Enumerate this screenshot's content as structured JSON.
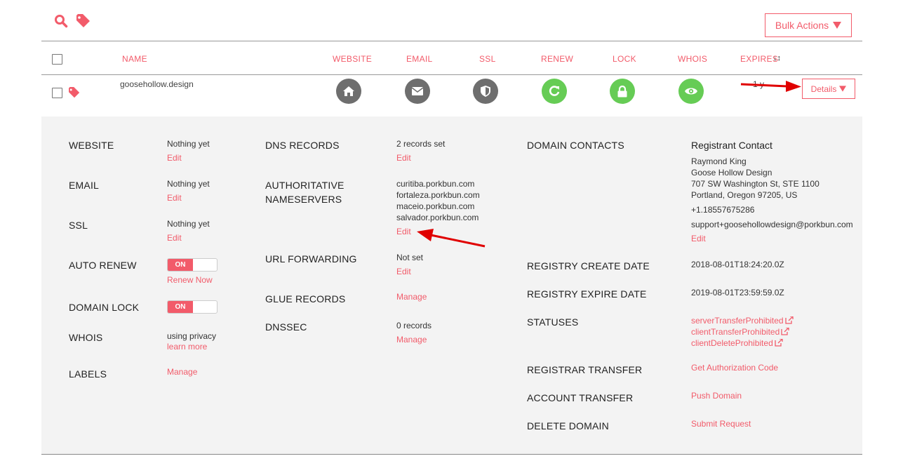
{
  "toolbar": {
    "bulk_actions_label": "Bulk Actions"
  },
  "table": {
    "headers": {
      "name": "NAME",
      "website": "WEBSITE",
      "email": "EMAIL",
      "ssl": "SSL",
      "renew": "RENEW",
      "lock": "LOCK",
      "whois": "WHOIS",
      "expires": "EXPIRES"
    },
    "row": {
      "domain": "goosehollow.design",
      "expires": "1 y",
      "details_label": "Details"
    }
  },
  "details": {
    "col1": {
      "website": {
        "label": "WEBSITE",
        "value": "Nothing yet",
        "action": "Edit"
      },
      "email": {
        "label": "EMAIL",
        "value": "Nothing yet",
        "action": "Edit"
      },
      "ssl": {
        "label": "SSL",
        "value": "Nothing yet",
        "action": "Edit"
      },
      "auto_renew": {
        "label": "AUTO RENEW",
        "toggle": "ON",
        "action": "Renew Now"
      },
      "domain_lock": {
        "label": "DOMAIN LOCK",
        "toggle": "ON"
      },
      "whois": {
        "label": "WHOIS",
        "value": "using privacy",
        "action": "learn more"
      },
      "labels": {
        "label": "LABELS",
        "action": "Manage"
      }
    },
    "col2": {
      "dns": {
        "label": "DNS RECORDS",
        "value": "2 records set",
        "action": "Edit"
      },
      "nameservers": {
        "label_line1": "AUTHORITATIVE",
        "label_line2": "NAMESERVERS",
        "values": [
          "curitiba.porkbun.com",
          "fortaleza.porkbun.com",
          "maceio.porkbun.com",
          "salvador.porkbun.com"
        ],
        "action": "Edit"
      },
      "url_forwarding": {
        "label": "URL FORWARDING",
        "value": "Not set",
        "action": "Edit"
      },
      "glue": {
        "label": "GLUE RECORDS",
        "action": "Manage"
      },
      "dnssec": {
        "label": "DNSSEC",
        "value": "0 records",
        "action": "Manage"
      }
    },
    "col3": {
      "contacts": {
        "label": "DOMAIN CONTACTS",
        "title": "Registrant Contact",
        "name": "Raymond King",
        "org": "Goose Hollow Design",
        "address1": "707 SW Washington St, STE 1100",
        "address2": "Portland, Oregon 97205, US",
        "phone": "+1.18557675286",
        "email": "support+goosehollowdesign@porkbun.com",
        "action": "Edit"
      },
      "create_date": {
        "label": "REGISTRY CREATE DATE",
        "value": "2018-08-01T18:24:20.0Z"
      },
      "expire_date": {
        "label": "REGISTRY EXPIRE DATE",
        "value": "2019-08-01T23:59:59.0Z"
      },
      "statuses": {
        "label": "STATUSES",
        "values": [
          "serverTransferProhibited",
          "clientTransferProhibited",
          "clientDeleteProhibited"
        ]
      },
      "registrar_transfer": {
        "label": "REGISTRAR TRANSFER",
        "action": "Get Authorization Code"
      },
      "account_transfer": {
        "label": "ACCOUNT TRANSFER",
        "action": "Push Domain"
      },
      "delete_domain": {
        "label": "DELETE DOMAIN",
        "action": "Submit Request"
      }
    }
  },
  "colors": {
    "accent": "#f25b6a",
    "panel_bg": "#f3f3f3",
    "icon_gray": "#6e6e6e",
    "icon_green": "#66cc55",
    "arrow_red": "#e00000"
  },
  "icons": [
    "search-icon",
    "tag-icon",
    "home-icon",
    "envelope-icon",
    "shield-icon",
    "refresh-icon",
    "lock-icon",
    "eye-icon",
    "sort-icon",
    "external-link-icon"
  ]
}
